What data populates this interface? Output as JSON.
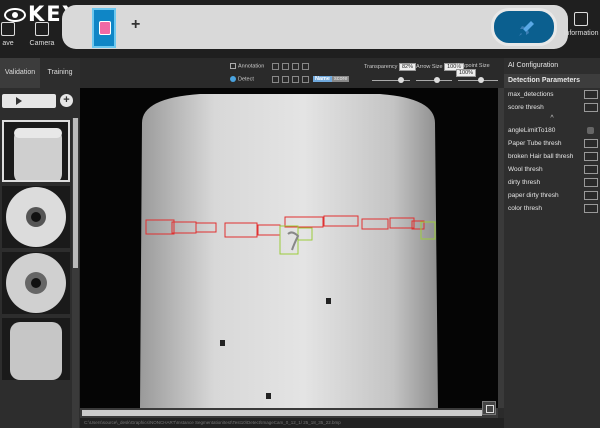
{
  "app": {
    "logo_text": "KEYETECH"
  },
  "toolbar_left": {
    "save_label": "ave",
    "camera_label": "Camera"
  },
  "toolbar_right": {
    "information_label": "Information"
  },
  "left_panel": {
    "tabs": [
      {
        "label": "Validation",
        "active": true
      },
      {
        "label": "Training",
        "active": false
      }
    ]
  },
  "view_toolbar": {
    "annotation_label": "Annotation",
    "detect_label": "Detect",
    "name_label": "Name",
    "score_label": "score",
    "transparency_label": "Transparency",
    "transparency_value": "82%",
    "arrow_size_label": "Arrow Size",
    "arrow_size_value": "100%",
    "keypoint_size_label": "Keypoint Size",
    "keypoint_size_value": "100%",
    "transparency_level": 0.82,
    "arrow_size_level": 0.6,
    "keypoint_size_level": 0.6
  },
  "status_bar": {
    "path": "C:\\Users\\source\\_desk\\Graphics\\NONCHART\\Instance Segmentation\\test\\Test10\\Detect\\ImageCam_0_12_1/ 25_18_35_22.bmp"
  },
  "right_panel": {
    "title": "AI Configuration",
    "section": "Detection Parameters",
    "params_top": [
      {
        "label": "max_detections"
      },
      {
        "label": "score thresh"
      }
    ],
    "angle_label": "angleLimitTo180",
    "params_bottom": [
      {
        "label": "Paper Tube thresh"
      },
      {
        "label": "broken Hair ball thresh"
      },
      {
        "label": "Wool thresh"
      },
      {
        "label": "dirty thresh"
      },
      {
        "label": "paper dirty thresh"
      },
      {
        "label": "color thresh"
      }
    ]
  },
  "colors": {
    "accent": "#0f86c6",
    "detect_red": "#e03030",
    "detect_green": "#9ccc3c"
  }
}
